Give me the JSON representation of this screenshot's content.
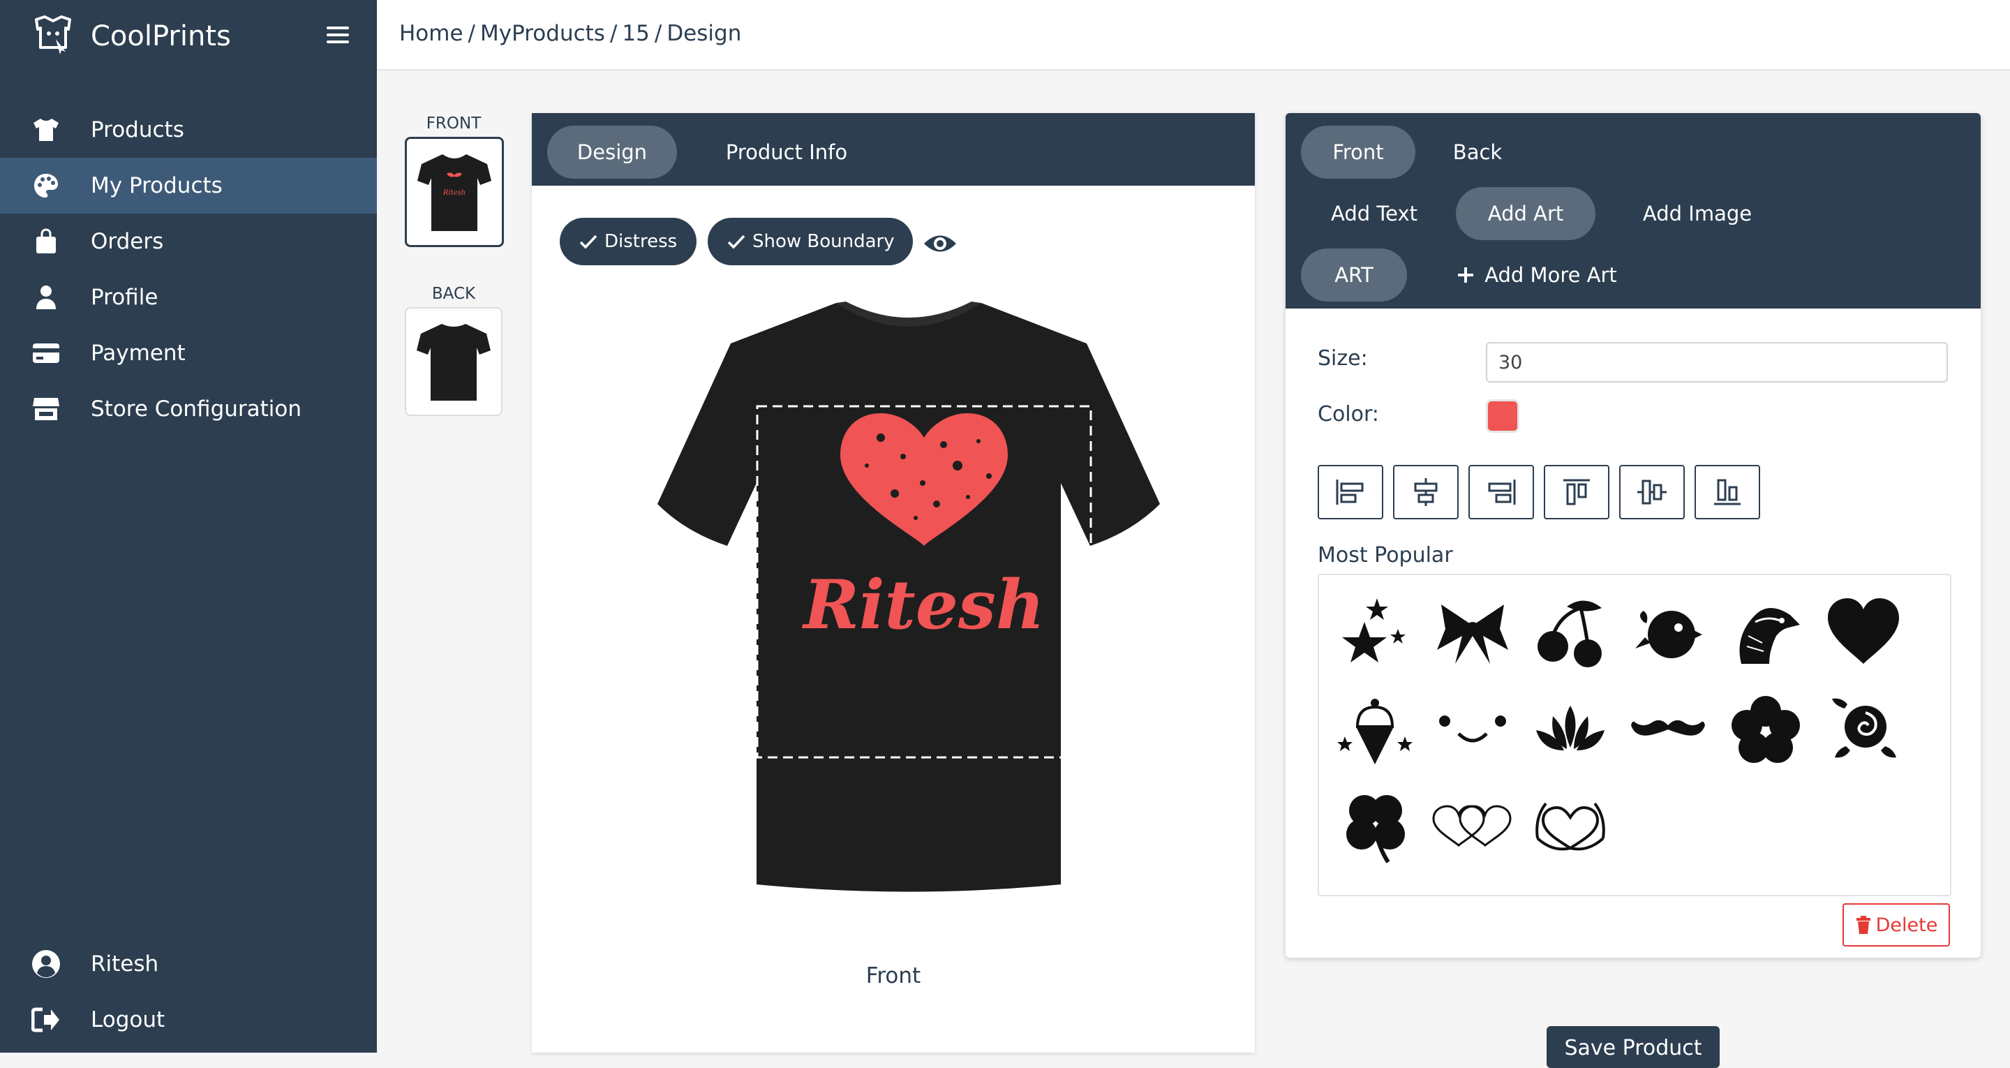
{
  "app": {
    "brand": "CoolPrints"
  },
  "sidebar": {
    "items": [
      {
        "label": "Products",
        "icon": "tshirt-icon"
      },
      {
        "label": "My Products",
        "icon": "palette-icon",
        "active": true
      },
      {
        "label": "Orders",
        "icon": "shopping-bag-icon"
      },
      {
        "label": "Profile",
        "icon": "user-icon"
      },
      {
        "label": "Payment",
        "icon": "credit-card-icon"
      },
      {
        "label": "Store Configuration",
        "icon": "store-icon"
      }
    ],
    "footer": [
      {
        "label": "Ritesh",
        "icon": "user-circle-icon"
      },
      {
        "label": "Logout",
        "icon": "logout-icon"
      }
    ]
  },
  "breadcrumb": {
    "items": [
      "Home",
      "MyProducts",
      "15",
      "Design"
    ],
    "separator": "/"
  },
  "views": {
    "front_label": "FRONT",
    "back_label": "BACK"
  },
  "design": {
    "tabs": [
      {
        "label": "Design",
        "active": true
      },
      {
        "label": "Product Info"
      }
    ],
    "toggles": {
      "distress": "Distress",
      "show_boundary": "Show Boundary"
    },
    "shirt_text": "Ritesh",
    "caption": "Front"
  },
  "art_panel": {
    "side_tabs": [
      {
        "label": "Front",
        "active": true
      },
      {
        "label": "Back"
      }
    ],
    "mode_tabs": [
      {
        "label": "Add Text"
      },
      {
        "label": "Add Art",
        "active": true
      },
      {
        "label": "Add Image"
      }
    ],
    "art_tab": "ART",
    "add_more": "Add More Art",
    "size_label": "Size:",
    "size_value": "30",
    "color_label": "Color:",
    "color_value": "#f05454",
    "most_popular": "Most Popular",
    "delete_label": "Delete",
    "arts": [
      "stars",
      "bow",
      "cherries",
      "bird",
      "eagle",
      "heart",
      "ice-cream",
      "smiley",
      "lotus",
      "mustache",
      "flower",
      "rose",
      "clover",
      "double-hearts",
      "heart-hands"
    ]
  },
  "save_label": "Save Product",
  "colors": {
    "sidebar": "#2c3e50",
    "active": "#3d5a78",
    "accent": "#f05454"
  }
}
